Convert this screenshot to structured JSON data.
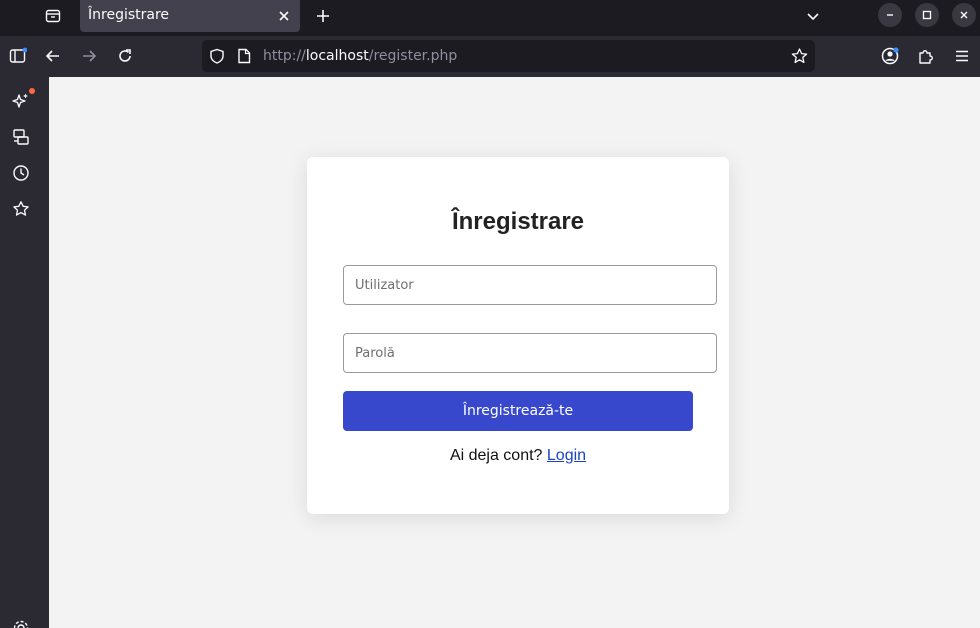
{
  "browser": {
    "tab": {
      "title": "Înregistrare"
    },
    "url": {
      "scheme": "http://",
      "host": "localhost",
      "path": "/register.php"
    },
    "icons": {
      "tab_list": "folder-tabs-icon",
      "close_tab": "close-icon",
      "new_tab": "plus-icon",
      "list_all_tabs": "chevron-down-icon",
      "minimize": "minimize-icon",
      "maximize": "maximize-icon",
      "close_window": "close-icon",
      "sidebar_toggle": "sidebar-icon",
      "back": "arrow-left-icon",
      "forward": "arrow-right-icon",
      "reload": "reload-icon",
      "tracking_protection": "shield-icon",
      "page_info": "page-icon",
      "bookmark": "star-icon",
      "account": "account-icon",
      "extensions": "puzzle-icon",
      "menu": "hamburger-icon"
    }
  },
  "sidebar": {
    "items": [
      {
        "name": "ai-chatbot",
        "icon": "sparkle-icon"
      },
      {
        "name": "synced-tabs",
        "icon": "synced-tabs-icon"
      },
      {
        "name": "history",
        "icon": "clock-icon"
      },
      {
        "name": "bookmarks",
        "icon": "star-icon"
      }
    ],
    "settings_icon": "gear-icon"
  },
  "form": {
    "title": "Înregistrare",
    "username_placeholder": "Utilizator",
    "password_placeholder": "Parolă",
    "submit_label": "Înregistrează-te",
    "login_prompt": "Ai deja cont?",
    "login_link": "Login"
  },
  "colors": {
    "accent": "#3748cc",
    "link": "#1a43c7",
    "page_background": "#f3f3f3",
    "toolbar": "#2b2a33",
    "tabbar": "#1c1b22",
    "badge": "#ff6a3d"
  }
}
